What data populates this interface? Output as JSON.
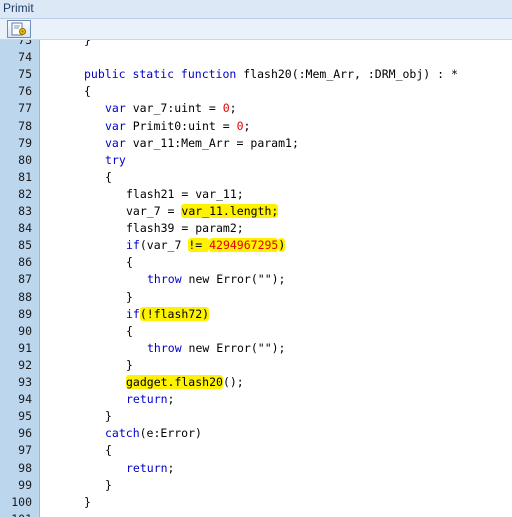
{
  "window": {
    "title": "Primit"
  },
  "toolbar": {
    "icon": "gear-page-icon"
  },
  "lines": [
    {
      "num": "73",
      "indent": 0,
      "tokens": [
        {
          "t": "}"
        }
      ]
    },
    {
      "num": "74",
      "indent": 0,
      "tokens": []
    },
    {
      "num": "75",
      "indent": 1,
      "tokens": [
        {
          "t": "public static function ",
          "k": "kw"
        },
        {
          "t": "flash20(:Mem_Arr, :DRM_obj) : *"
        }
      ]
    },
    {
      "num": "76",
      "indent": 1,
      "tokens": [
        {
          "t": "{"
        }
      ]
    },
    {
      "num": "77",
      "indent": 2,
      "tokens": [
        {
          "t": "var ",
          "k": "kw"
        },
        {
          "t": "var_7:uint = "
        },
        {
          "t": "0",
          "k": "num"
        },
        {
          "t": ";"
        }
      ]
    },
    {
      "num": "78",
      "indent": 2,
      "tokens": [
        {
          "t": "var ",
          "k": "kw"
        },
        {
          "t": "Primit0:uint = "
        },
        {
          "t": "0",
          "k": "num"
        },
        {
          "t": ";"
        }
      ]
    },
    {
      "num": "79",
      "indent": 2,
      "tokens": [
        {
          "t": "var ",
          "k": "kw"
        },
        {
          "t": "var_11:Mem_Arr = param1;"
        }
      ]
    },
    {
      "num": "80",
      "indent": 2,
      "tokens": [
        {
          "t": "try",
          "k": "kw"
        }
      ]
    },
    {
      "num": "81",
      "indent": 2,
      "tokens": [
        {
          "t": "{"
        }
      ]
    },
    {
      "num": "82",
      "indent": 3,
      "tokens": [
        {
          "t": "flash21 = var_11;"
        }
      ]
    },
    {
      "num": "83",
      "indent": 3,
      "tokens": [
        {
          "t": "var_7 = "
        },
        {
          "t": "var_11.length;",
          "h": true
        }
      ]
    },
    {
      "num": "84",
      "indent": 3,
      "tokens": [
        {
          "t": "flash39 = param2;"
        }
      ]
    },
    {
      "num": "85",
      "indent": 3,
      "tokens": [
        {
          "t": "if",
          "k": "kw"
        },
        {
          "t": "(var_7 "
        },
        {
          "t": "!= ",
          "h": true
        },
        {
          "t": "4294967295",
          "k": "num",
          "h": true
        },
        {
          "t": ")",
          "h": true
        }
      ]
    },
    {
      "num": "86",
      "indent": 3,
      "tokens": [
        {
          "t": "{"
        }
      ]
    },
    {
      "num": "87",
      "indent": 4,
      "tokens": [
        {
          "t": "throw ",
          "k": "kw"
        },
        {
          "t": "new Error(\"\");"
        }
      ]
    },
    {
      "num": "88",
      "indent": 3,
      "tokens": [
        {
          "t": "}"
        }
      ]
    },
    {
      "num": "89",
      "indent": 3,
      "tokens": [
        {
          "t": "if",
          "k": "kw"
        },
        {
          "t": "(!flash72)",
          "h": true
        }
      ]
    },
    {
      "num": "90",
      "indent": 3,
      "tokens": [
        {
          "t": "{"
        }
      ]
    },
    {
      "num": "91",
      "indent": 4,
      "tokens": [
        {
          "t": "throw ",
          "k": "kw"
        },
        {
          "t": "new Error(\"\");"
        }
      ]
    },
    {
      "num": "92",
      "indent": 3,
      "tokens": [
        {
          "t": "}"
        }
      ]
    },
    {
      "num": "93",
      "indent": 3,
      "tokens": [
        {
          "t": "gadget.flash20",
          "h": true
        },
        {
          "t": "();"
        }
      ]
    },
    {
      "num": "94",
      "indent": 3,
      "tokens": [
        {
          "t": "return",
          "k": "kw"
        },
        {
          "t": ";"
        }
      ]
    },
    {
      "num": "95",
      "indent": 2,
      "tokens": [
        {
          "t": "}"
        }
      ]
    },
    {
      "num": "96",
      "indent": 2,
      "tokens": [
        {
          "t": "catch",
          "k": "kw"
        },
        {
          "t": "(e:Error)"
        }
      ]
    },
    {
      "num": "97",
      "indent": 2,
      "tokens": [
        {
          "t": "{"
        }
      ]
    },
    {
      "num": "98",
      "indent": 3,
      "tokens": [
        {
          "t": "return",
          "k": "kw"
        },
        {
          "t": ";"
        }
      ]
    },
    {
      "num": "99",
      "indent": 2,
      "tokens": [
        {
          "t": "}"
        }
      ]
    },
    {
      "num": "100",
      "indent": 1,
      "tokens": [
        {
          "t": "}"
        }
      ]
    },
    {
      "num": "101",
      "indent": 0,
      "tokens": []
    }
  ],
  "colors": {
    "keyword": "#0000cc",
    "number": "#e40000",
    "highlight": "#fff200",
    "gutter": "#bcd6ee"
  }
}
